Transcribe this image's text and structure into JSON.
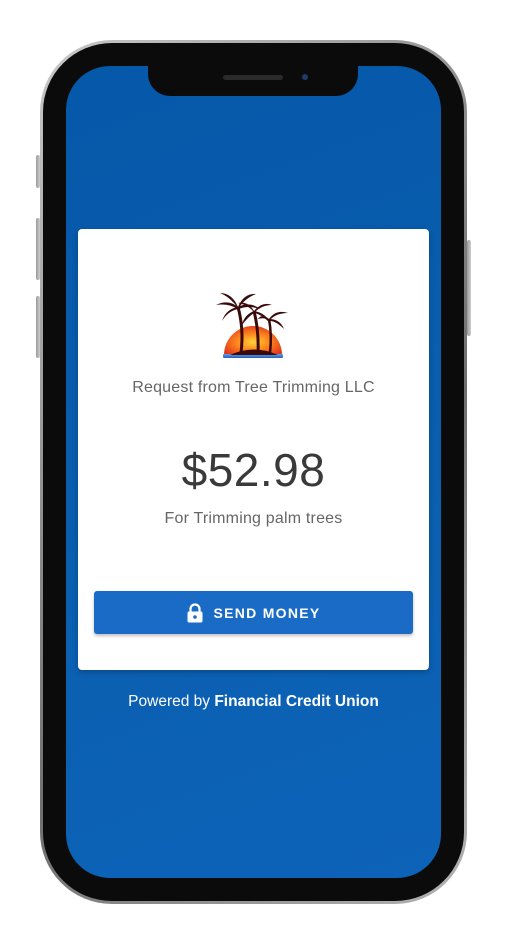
{
  "request": {
    "business_logo_icon": "palm-trees-sunset-logo",
    "from_text": "Request from Tree Trimming LLC",
    "amount": "$52.98",
    "memo": "For Trimming palm trees"
  },
  "action": {
    "icon": "lock-icon",
    "label": "SEND MONEY"
  },
  "footer": {
    "prefix": "Powered by",
    "brand": "Financial Credit Union"
  },
  "colors": {
    "screen_background": "#0a5fb0",
    "button": "#1a6bc6",
    "card": "#ffffff"
  }
}
